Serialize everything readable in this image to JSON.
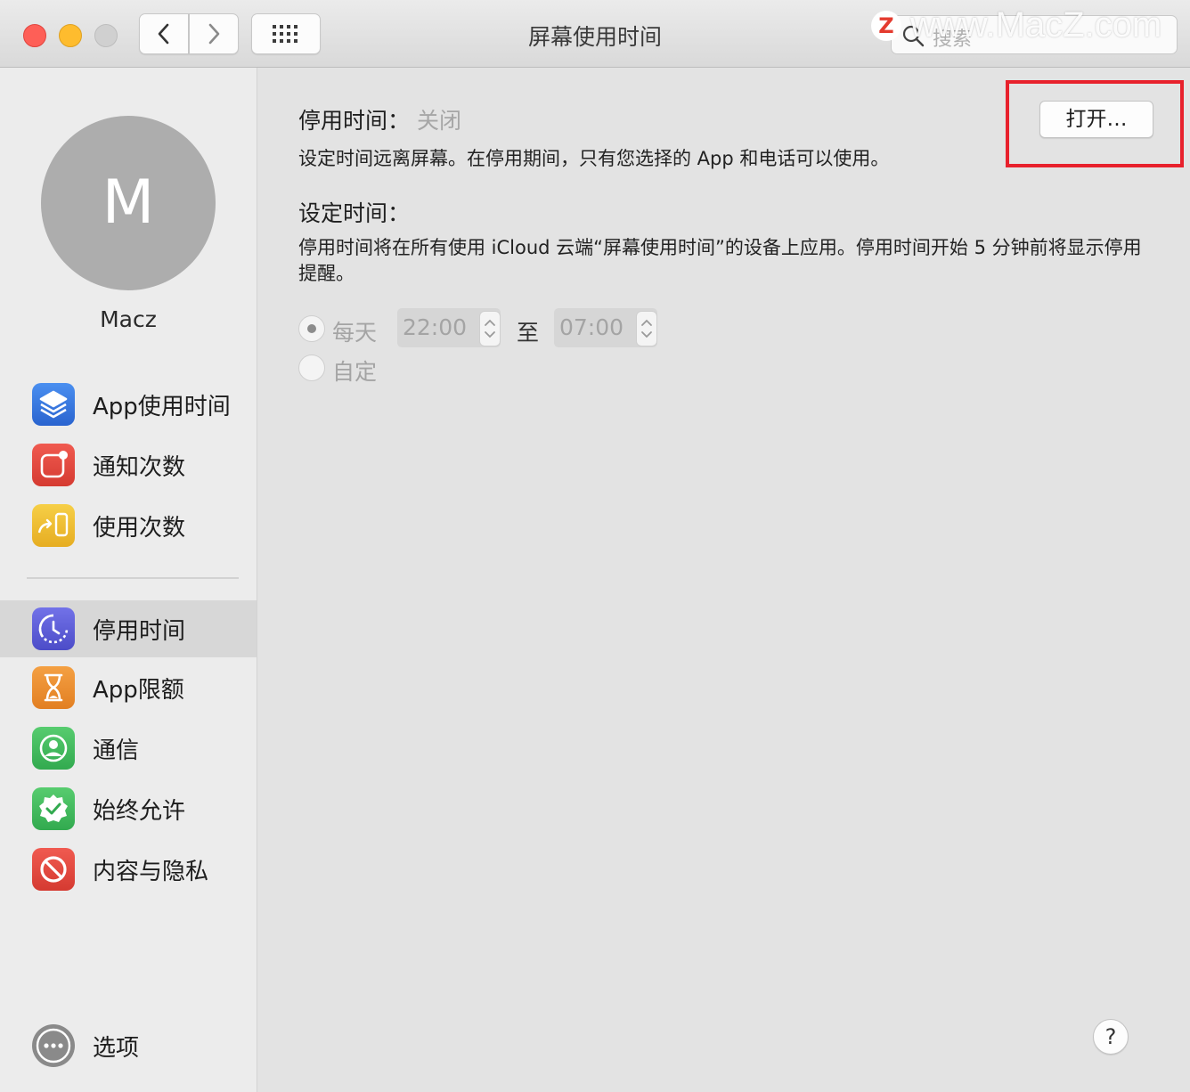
{
  "window": {
    "title": "屏幕使用时间"
  },
  "search": {
    "placeholder": "搜索"
  },
  "watermark": {
    "badge": "Z",
    "text": "www.MacZ.com"
  },
  "user": {
    "initial": "M",
    "name": "Macz"
  },
  "sidebar": {
    "items": [
      {
        "label": "App使用时间",
        "icon": "stack-icon",
        "color": "#2f72d9"
      },
      {
        "label": "通知次数",
        "icon": "notification-icon",
        "color": "#e0433b"
      },
      {
        "label": "使用次数",
        "icon": "pickup-icon",
        "color": "#e9b92f"
      },
      {
        "label": "停用时间",
        "icon": "downtime-icon",
        "color": "#5b5bd6",
        "selected": true
      },
      {
        "label": "App限额",
        "icon": "hourglass-icon",
        "color": "#e98b2b"
      },
      {
        "label": "通信",
        "icon": "contact-icon",
        "color": "#3dbb5c"
      },
      {
        "label": "始终允许",
        "icon": "check-badge-icon",
        "color": "#3dbb5c"
      },
      {
        "label": "内容与隐私",
        "icon": "block-icon",
        "color": "#e0433b"
      }
    ],
    "options_label": "选项"
  },
  "downtime": {
    "title": "停用时间：",
    "status": "关闭",
    "description": "设定时间远离屏幕。在停用期间，只有您选择的 App 和电话可以使用。",
    "open_button": "打开…",
    "schedule_title": "设定时间：",
    "schedule_desc": "停用时间将在所有使用 iCloud 云端“屏幕使用时间”的设备上应用。停用时间开始 5 分钟前将显示停用提醒。",
    "every_day_label": "每天",
    "start_time": "22:00",
    "to_label": "至",
    "end_time": "07:00",
    "custom_label": "自定"
  },
  "help_label": "?"
}
